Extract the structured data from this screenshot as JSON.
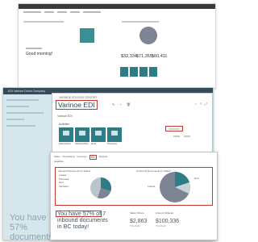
{
  "top": {
    "greeting": "Good morning!",
    "kpis": [
      {
        "value": "$32,334",
        "label": ""
      },
      {
        "value": "$71,355",
        "label": ""
      },
      {
        "value": "$60,411",
        "label": ""
      }
    ]
  },
  "middle": {
    "app_bar_title": "EDI Varinoe Demo Company",
    "breadcrumb": "VARINOE EDI ROLE CENTER",
    "page_title": "Varinoe EDI",
    "section_label": "Varinoe EDI",
    "subsection_label": "Activities",
    "tiles": [
      {
        "label": "Inbound Docs"
      },
      {
        "label": "Outbound Docs"
      },
      {
        "label": "Errors"
      },
      {
        "label": "Processing"
      }
    ],
    "left_status": "You have 57% documents in"
  },
  "front": {
    "menu": [
      "Sales",
      "Purchasing",
      "Inventory",
      "EDI",
      "Reports"
    ],
    "menu_selected": "EDI",
    "subheader": "Headline",
    "chart_left_title": "Inbound Documents by Status",
    "chart_right_title": "Outbound Documents by Status",
    "legend": [
      "Created",
      "Processed",
      "Error",
      "Cancelled"
    ],
    "headline": "You have 57% of 7 inbound documents in BC today!",
    "kpis": [
      {
        "title": "Sales Orders",
        "value": "$2,863",
        "sub": "This Month"
      },
      {
        "title": "Amount Shipped",
        "value": "$100,336",
        "sub": "This Month"
      }
    ],
    "pie_labels": [
      "Created",
      "Error"
    ]
  },
  "colors": {
    "teal": "#2e7d86",
    "accent_red": "#c9342d",
    "grey_pie": "#7d8594",
    "app_bar": "#384a57"
  }
}
